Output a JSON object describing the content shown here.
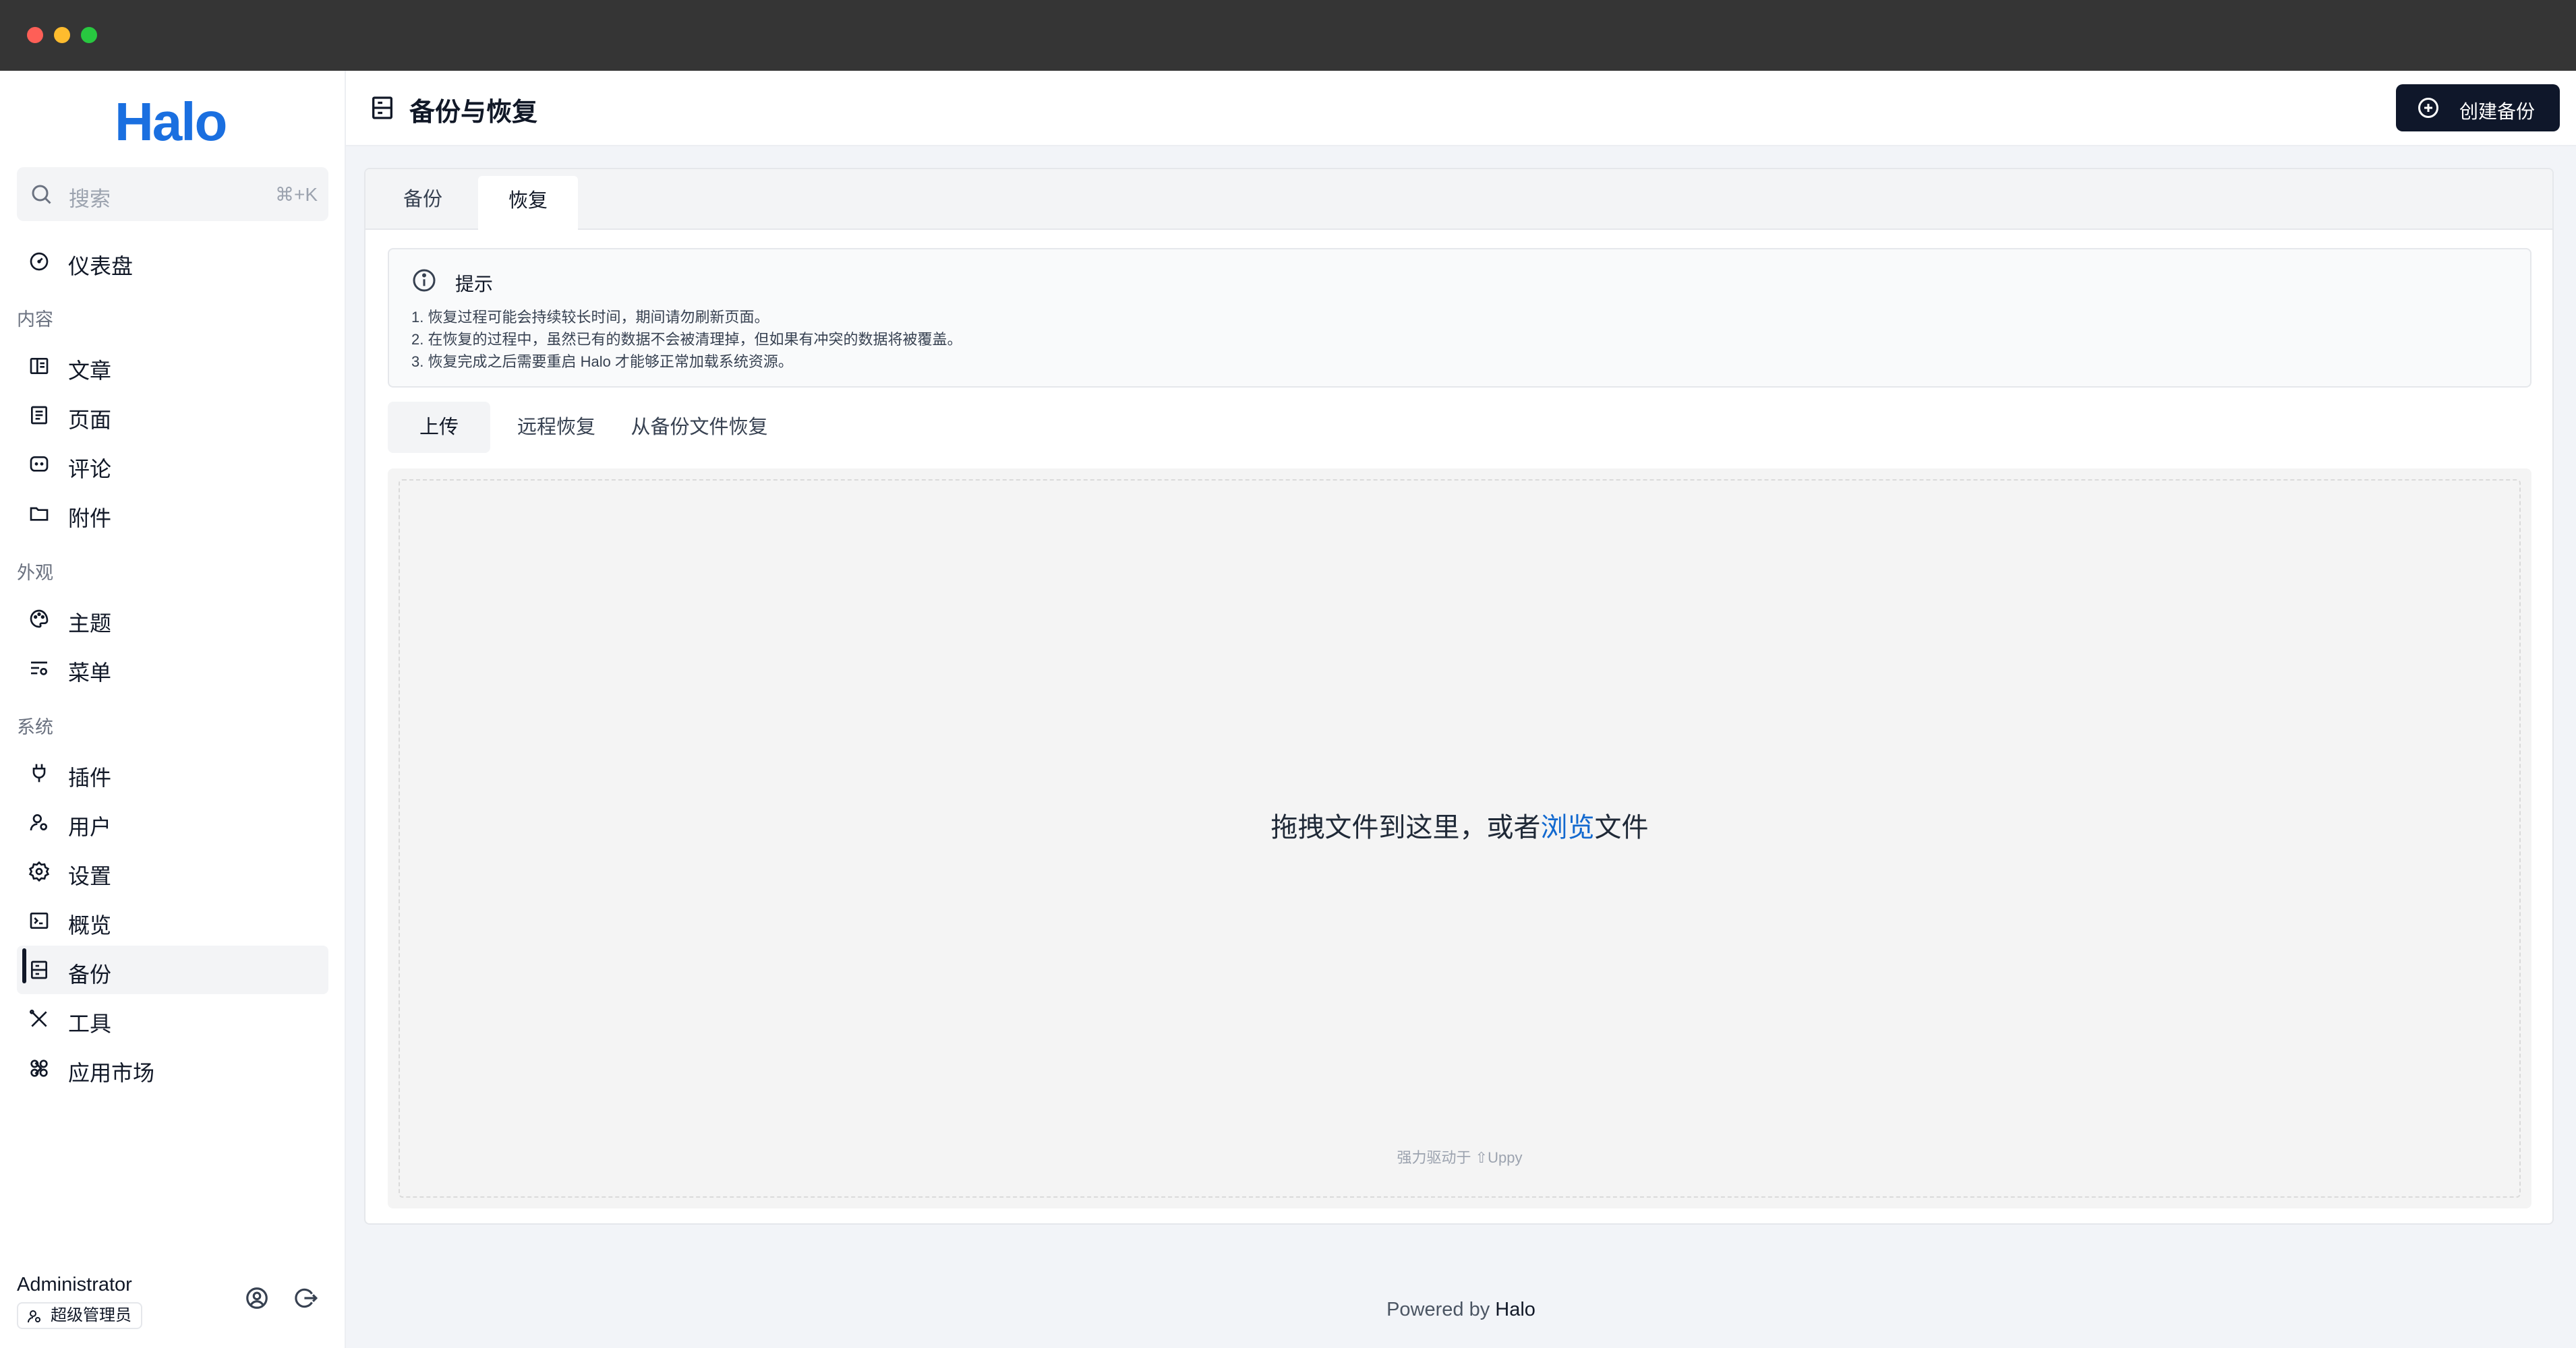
{
  "app": {
    "logo": "Halo"
  },
  "search": {
    "placeholder": "搜索",
    "shortcut": "⌘+K"
  },
  "sidebar": {
    "dashboard": "仪表盘",
    "groups": {
      "content": "内容",
      "appearance": "外观",
      "system": "系统"
    },
    "content_items": [
      "文章",
      "页面",
      "评论",
      "附件"
    ],
    "appearance_items": [
      "主题",
      "菜单"
    ],
    "system_items": [
      "插件",
      "用户",
      "设置",
      "概览",
      "备份",
      "工具",
      "应用市场"
    ],
    "active_item": "备份"
  },
  "user": {
    "name": "Administrator",
    "role": "超级管理员"
  },
  "header": {
    "title": "备份与恢复",
    "create_button": "创建备份"
  },
  "tabs": [
    "备份",
    "恢复"
  ],
  "active_tab": "恢复",
  "alert": {
    "title": "提示",
    "lines": [
      "1. 恢复过程可能会持续较长时间，期间请勿刷新页面。",
      "2. 在恢复的过程中，虽然已有的数据不会被清理掉，但如果有冲突的数据将被覆盖。",
      "3. 恢复完成之后需要重启 Halo 才能够正常加载系统资源。"
    ]
  },
  "restore_tabs": [
    "上传",
    "远程恢复",
    "从备份文件恢复"
  ],
  "active_restore_tab": "上传",
  "dropzone": {
    "text_before": "拖拽文件到这里，或者",
    "browse": "浏览",
    "text_after": "文件",
    "powered_by": "强力驱动于 ⇧Uppy"
  },
  "footer": {
    "prefix": "Powered by ",
    "brand": "Halo"
  },
  "colors": {
    "accent": "#1a6fe0",
    "primary_button": "#0f172a",
    "link": "#1269cf"
  }
}
